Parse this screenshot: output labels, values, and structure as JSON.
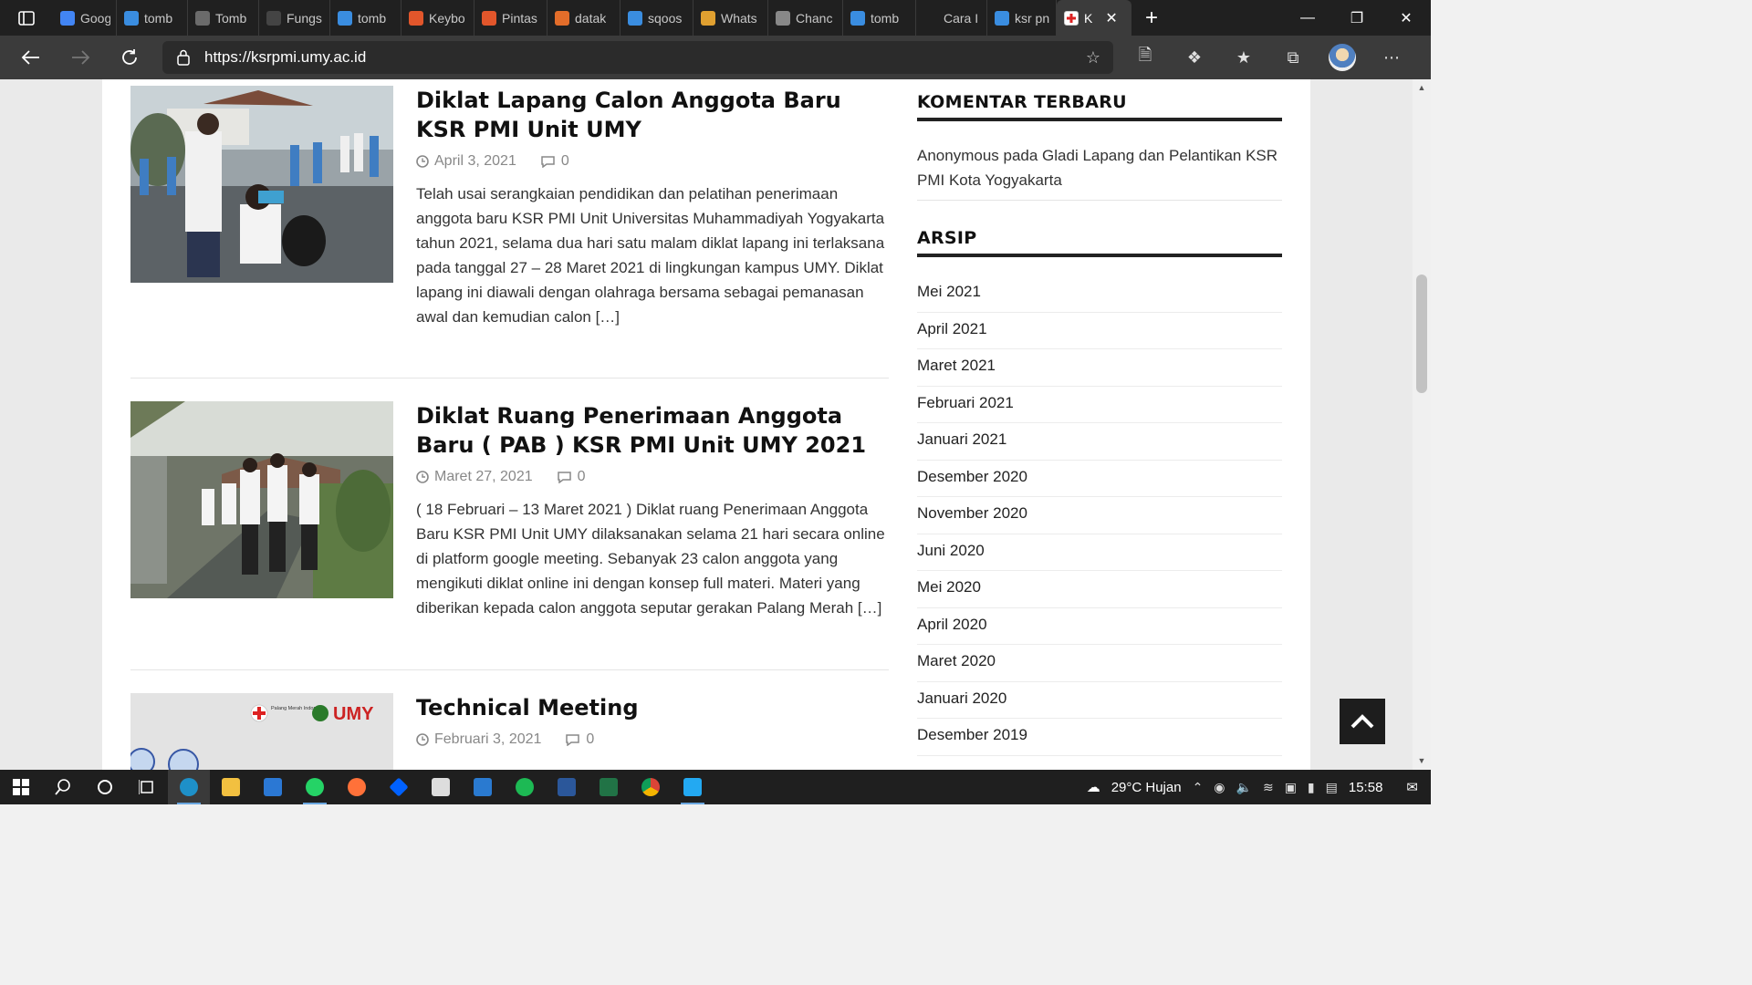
{
  "browser": {
    "tabs": [
      {
        "label": "Googl",
        "icon": "chrome-icon",
        "color": "#4285f4"
      },
      {
        "label": "tomb",
        "icon": "bing-icon",
        "color": "#3a8de0"
      },
      {
        "label": "Tomb",
        "icon": "site-icon",
        "color": "#6b6b6b"
      },
      {
        "label": "Fungs",
        "icon": "s-icon",
        "color": "#444444"
      },
      {
        "label": "tomb",
        "icon": "bing-icon",
        "color": "#3a8de0"
      },
      {
        "label": "Keybo",
        "icon": "windows-icon",
        "color": "#e2562b"
      },
      {
        "label": "Pintas",
        "icon": "windows-icon",
        "color": "#e2562b"
      },
      {
        "label": "datak",
        "icon": "blogger-icon",
        "color": "#e36d2a"
      },
      {
        "label": "sqoos",
        "icon": "bing-icon",
        "color": "#3a8de0"
      },
      {
        "label": "Whats",
        "icon": "whatsapp-icon",
        "color": "#e0a030"
      },
      {
        "label": "Chanc",
        "icon": "site-icon",
        "color": "#888888"
      },
      {
        "label": "tomb",
        "icon": "bing-icon",
        "color": "#3a8de0"
      },
      {
        "label": "Cara I",
        "icon": "blank-icon",
        "color": "#202020"
      },
      {
        "label": "ksr pn",
        "icon": "bing-icon",
        "color": "#3a8de0"
      },
      {
        "label": "K",
        "icon": "pmi-icon",
        "color": "#ffffff",
        "active": true
      }
    ],
    "url": "https://ksrpmi.umy.ac.id"
  },
  "posts": [
    {
      "title": "Diklat Lapang Calon Anggota Baru KSR PMI Unit UMY",
      "date": "April 3, 2021",
      "comments": "0",
      "excerpt": "Telah usai serangkaian pendidikan dan pelatihan penerimaan anggota baru KSR PMI Unit Universitas Muhammadiyah Yogyakarta tahun 2021, selama dua hari satu malam diklat lapang ini terlaksana pada tanggal 27 – 28 Maret 2021 di lingkungan kampus UMY. Diklat lapang ini diawali dengan olahraga bersama sebagai pemanasan awal dan kemudian calon […]"
    },
    {
      "title": "Diklat Ruang Penerimaan Anggota Baru ( PAB ) KSR PMI Unit UMY 2021",
      "date": "Maret 27, 2021",
      "comments": "0",
      "excerpt": "( 18 Februari – 13 Maret 2021 ) Diklat ruang Penerimaan Anggota Baru KSR PMI Unit UMY dilaksanakan selama 21 hari secara online di platform google meeting. Sebanyak 23 calon anggota yang mengikuti diklat online ini dengan konsep full materi. Materi yang diberikan kepada calon anggota seputar gerakan Palang Merah […]"
    },
    {
      "title": "Technical Meeting",
      "date": "Februari 3, 2021",
      "comments": "0",
      "thumb_text": {
        "pmi": "Palang Merah Indonesia",
        "umy": "UMY"
      }
    }
  ],
  "sidebar": {
    "recent_comments_title": "KOMENTAR TERBARU",
    "recent_comment": "Anonymous pada Gladi Lapang dan Pelantikan KSR PMI Kota Yogyakarta",
    "archive_title": "ARSIP",
    "archives": [
      "Mei 2021",
      "April 2021",
      "Maret 2021",
      "Februari 2021",
      "Januari 2021",
      "Desember 2020",
      "November 2020",
      "Juni 2020",
      "Mei 2020",
      "April 2020",
      "Maret 2020",
      "Januari 2020",
      "Desember 2019"
    ]
  },
  "taskbar": {
    "weather": "29°C  Hujan",
    "time": "15:58"
  }
}
